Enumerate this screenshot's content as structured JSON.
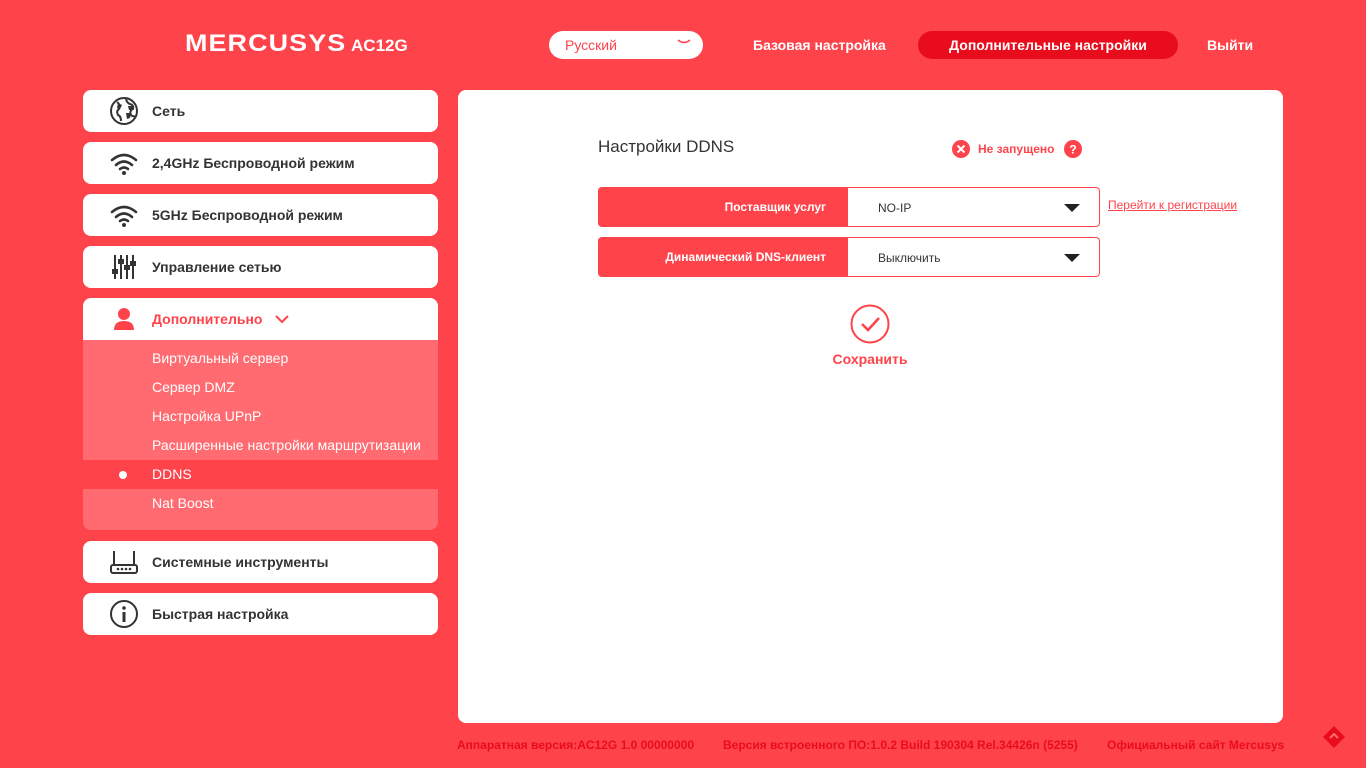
{
  "header": {
    "brand": "MERCUSYS",
    "model": "AC12G",
    "language": "Русский",
    "nav_basic": "Базовая настройка",
    "nav_advanced": "Дополнительные настройки",
    "nav_logout": "Выйти"
  },
  "sidebar": {
    "items": [
      {
        "label": "Сеть",
        "icon": "globe-icon"
      },
      {
        "label": "2,4GHz Беспроводной режим",
        "icon": "wifi-icon"
      },
      {
        "label": "5GHz Беспроводной режим",
        "icon": "wifi-icon"
      },
      {
        "label": "Управление сетью",
        "icon": "sliders-icon"
      },
      {
        "label": "Дополнительно",
        "icon": "user-icon"
      },
      {
        "label": "Системные инструменты",
        "icon": "router-icon"
      },
      {
        "label": "Быстрая настройка",
        "icon": "info-icon"
      }
    ],
    "submenu": [
      "Виртуальный сервер",
      "Сервер DMZ",
      "Настройка UPnP",
      "Расширенные настройки маршрутизации",
      "DDNS",
      "Nat Boost"
    ]
  },
  "main": {
    "title": "Настройки DDNS",
    "status": "Не запущено",
    "provider_label": "Поставщик услуг",
    "provider_value": "NO-IP",
    "register_link": "Перейти к регистрации",
    "dns_client_label": "Динамический DNS-клиент",
    "dns_client_value": "Выключить",
    "save_label": "Сохранить"
  },
  "footer": {
    "hardware": "Аппаратная версия:AC12G 1.0 00000000",
    "firmware": "Версия встроенного ПО:1.0.2 Build 190304 Rel.34426n (5255)",
    "site": "Официальный сайт Mercusys"
  },
  "colors": {
    "background": "#ff434b",
    "accent_dark": "#e90c1c",
    "submenu_bg": "#ff6b71"
  }
}
